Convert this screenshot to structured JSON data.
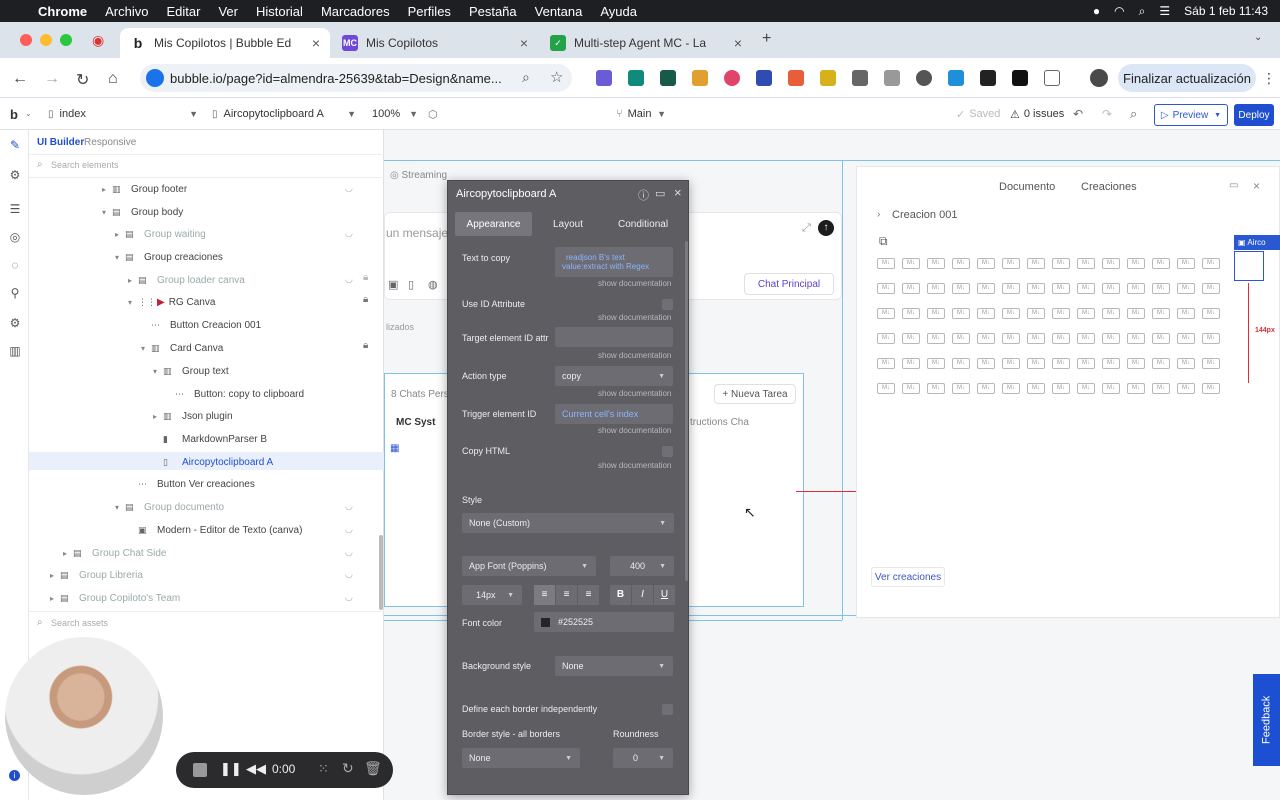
{
  "menubar": {
    "app": "Chrome",
    "items": [
      "Archivo",
      "Editar",
      "Ver",
      "Historial",
      "Marcadores",
      "Perfiles",
      "Pestaña",
      "Ventana",
      "Ayuda"
    ],
    "clock": "Sáb 1 feb  11:43"
  },
  "tabs": [
    {
      "label": "Mis Copilotos | Bubble Ed",
      "fav": "b",
      "color": "#222"
    },
    {
      "label": "Mis Copilotos",
      "fav": "MC",
      "color": "#6d4bd8"
    },
    {
      "label": "Multi-step Agent MC - La",
      "fav": "✓",
      "color": "#22a34a"
    }
  ],
  "address": {
    "url": "bubble.io/page?id=almendra-25639&tab=Design&name...",
    "update": "Finalizar actualización"
  },
  "toolbar": {
    "page": "index",
    "element": "Aircopytoclipboard A",
    "zoom": "100%",
    "branch": "Main",
    "saved": "Saved",
    "issues": "0 issues",
    "preview": "Preview",
    "deploy": "Deploy"
  },
  "left": {
    "tab1": "UI Builder",
    "tab2": "Responsive",
    "search": "Search elements",
    "assets": "Search assets",
    "tree": [
      "Group footer",
      "Group body",
      "Group waiting",
      "Group creaciones",
      "Group loader canva",
      "RG Canva",
      "Button Creacion 001",
      "Card Canva",
      "Group text",
      "Button: copy to clipboard",
      "Json plugin",
      "MarkdownParser B",
      "Aircopytoclipboard A",
      "Button Ver creaciones",
      "Group documento",
      "Modern - Editor de Texto (canva)",
      "Group Chat Side",
      "Group Libreria",
      "Group Copiloto's Team"
    ]
  },
  "canvas": {
    "streaming": "Streaming",
    "mensaje": "un mensaje",
    "chat": "Chat Principal",
    "lizados": "lizados",
    "chats": "8 Chats Perso",
    "nueva": "Nueva Tarea",
    "mcsyst": "MC Syst",
    "instr": "tructions Cha"
  },
  "dialog": {
    "title": "Aircopytoclipboard A",
    "tabs": [
      "Appearance",
      "Layout",
      "Conditional"
    ],
    "showdoc": "show documentation",
    "text_to_copy_label": "Text to copy",
    "text_to_copy_val1": "readjson B's text",
    "text_to_copy_val2": "value:extract with Regex",
    "use_id": "Use ID Attribute",
    "target": "Target element ID attr",
    "action_label": "Action type",
    "action_val": "copy",
    "trigger_label": "Trigger element ID",
    "trigger_val": "Current cell's index",
    "copy_html": "Copy HTML",
    "style_label": "Style",
    "style_val": "None (Custom)",
    "font": "App Font (Poppins)",
    "weight": "400",
    "size": "14px",
    "font_color_label": "Font color",
    "font_color_val": "#252525",
    "bg_label": "Background style",
    "bg_val": "None",
    "border_ind": "Define each border independently",
    "border_style": "Border style - all borders",
    "roundness": "Roundness",
    "border_val": "None",
    "round_val": "0"
  },
  "right": {
    "tab1": "Documento",
    "tab2": "Creaciones",
    "creacion": "Creacion 001",
    "airco": "Airco",
    "px144": "144px",
    "px617": "617px",
    "ver": "Ver creaciones"
  },
  "rec": {
    "time": "0:00"
  },
  "feedback": "Feedback"
}
